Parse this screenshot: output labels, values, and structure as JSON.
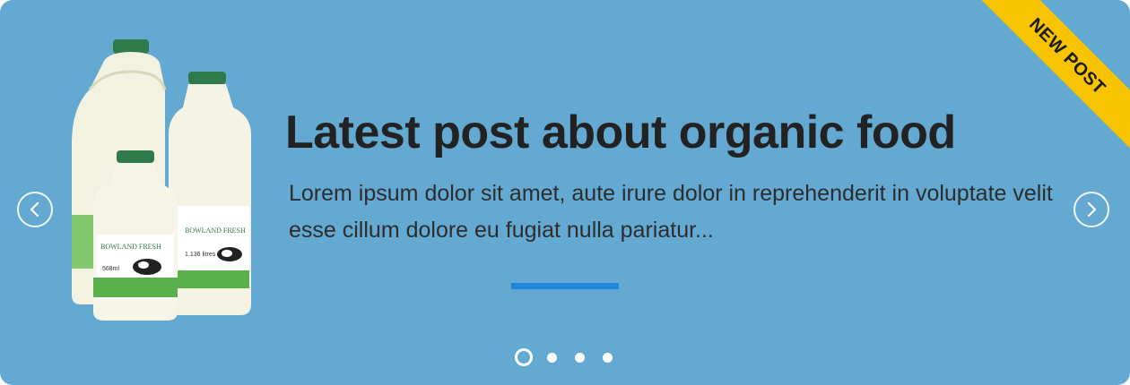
{
  "slide": {
    "title": "Latest post about organic food",
    "excerpt": "Lorem ipsum dolor sit amet, aute irure dolor in reprehenderit in voluptate velit esse cillum dolore eu fugiat nulla pariatur..."
  },
  "ribbon": {
    "label": "NEW POST"
  },
  "product": {
    "brand": "BOWLAND FRESH",
    "large_volume": "1.136 litres",
    "small_volume": "568ml"
  },
  "navigation": {
    "prev_icon": "chevron-left-icon",
    "next_icon": "chevron-right-icon"
  },
  "pagination": {
    "total": 4,
    "active_index": 0
  },
  "colors": {
    "background": "#63a9d2",
    "ribbon": "#f8c400",
    "accent_bar": "#1f86d8",
    "title": "#222222"
  }
}
